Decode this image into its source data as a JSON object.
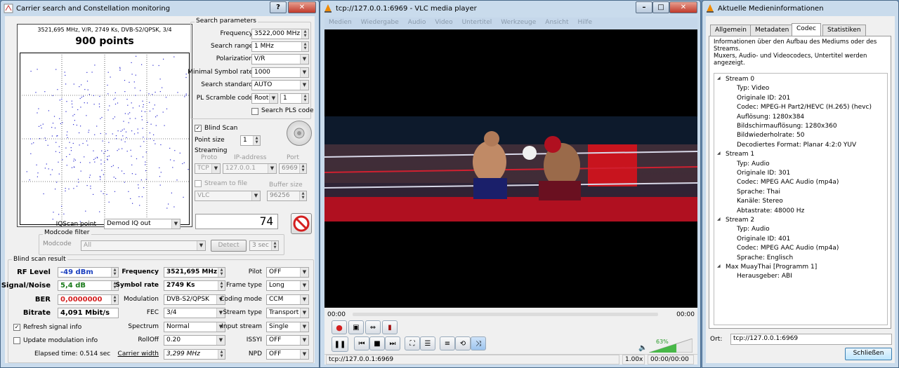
{
  "win1": {
    "title": "Carrier search and Constellation monitoring",
    "help_btn": "?",
    "info_line": "3521,695 MHz, V/R, 2749 Ks, DVB-S2/QPSK, 3/4",
    "points": "900 points",
    "search": {
      "header": "Search parameters",
      "frequency_label": "Frequency",
      "frequency_value": "3522,000 MHz",
      "range_label": "Search range",
      "range_value": "1 MHz",
      "polarization_label": "Polarization",
      "polarization_value": "V/R",
      "minsr_label": "Minimal Symbol rate",
      "minsr_value": "1000",
      "standard_label": "Search standard",
      "standard_value": "AUTO",
      "pls_label": "PL Scramble code",
      "pls_mode": "Root",
      "pls_value": "1",
      "search_pls_label": "Search PLS code"
    },
    "blind_scan_label": "Blind Scan",
    "point_size_label": "Point size",
    "point_size_value": "1",
    "streaming": {
      "header": "Streaming",
      "proto_label": "Proto",
      "ip_label": "IP-address",
      "port_label": "Port",
      "proto_value": "TCP",
      "ip_value": "127.0.0.1",
      "port_value": "6969",
      "to_file_label": "Stream to file",
      "buffer_label": "Buffer size",
      "player_value": "VLC",
      "buffer_value": "96256"
    },
    "iqscan_label": "IQScan point",
    "iqscan_value": "Demod IQ out",
    "counter": "74",
    "modcode": {
      "header": "Modcode filter",
      "label": "Modcode",
      "value": "All",
      "detect_btn": "Detect",
      "sec_value": "3 sec"
    },
    "result": {
      "header": "Blind scan result",
      "rf_label": "RF Level",
      "rf_value": "-49 dBm",
      "sn_label": "Signal/Noise",
      "sn_value": "5,4 dB",
      "ber_label": "BER",
      "ber_value": "0,0000000",
      "bitrate_label": "Bitrate",
      "bitrate_value": "4,091 Mbit/s",
      "freq_label": "Frequency",
      "freq_value": "3521,695 MHz",
      "sr_label": "Symbol rate",
      "sr_value": "2749 Ks",
      "mod_label": "Modulation",
      "mod_value": "DVB-S2/QPSK",
      "fec_label": "FEC",
      "fec_value": "3/4",
      "spectrum_label": "Spectrum",
      "spectrum_value": "Normal",
      "rolloff_label": "RollOff",
      "rolloff_value": "0.20",
      "cw_label": "Carrier width",
      "cw_value": "3,299 MHz",
      "pilot_label": "Pilot",
      "pilot_value": "OFF",
      "frametype_label": "Frame type",
      "frametype_value": "Long",
      "coding_label": "Coding mode",
      "coding_value": "CCM",
      "streamtype_label": "Stream type",
      "streamtype_value": "Transport",
      "inputstream_label": "Input stream",
      "inputstream_value": "Single",
      "issyi_label": "ISSYI",
      "issyi_value": "OFF",
      "npd_label": "NPD",
      "npd_value": "OFF"
    },
    "refresh_label": "Refresh signal info",
    "update_label": "Update modulation info",
    "elapsed": "Elapsed time: 0.514 sec"
  },
  "vlc": {
    "title": "tcp://127.0.0.1:6969 - VLC media player",
    "menu": [
      "Medien",
      "Wiedergabe",
      "Audio",
      "Video",
      "Untertitel",
      "Werkzeuge",
      "Ansicht",
      "Hilfe"
    ],
    "time_start": "00:00",
    "time_end": "00:00",
    "volume": "63%",
    "status_url": "tcp://127.0.0.1:6969",
    "speed": "1.00x",
    "time_status": "00:00/00:00"
  },
  "info": {
    "title": "Aktuelle Medieninformationen",
    "tabs": [
      "Allgemein",
      "Metadaten",
      "Codec",
      "Statistiken"
    ],
    "desc": [
      "Informationen über den Aufbau des Mediums oder des",
      "Streams.",
      "Muxers, Audio- und Videocodecs, Untertitel werden",
      "angezeigt."
    ],
    "tree": [
      {
        "t": "Stream 0",
        "lvl": 0
      },
      {
        "t": "Typ: Video",
        "lvl": 1
      },
      {
        "t": "Originale ID: 201",
        "lvl": 1
      },
      {
        "t": "Codec: MPEG-H Part2/HEVC (H.265) (hevc)",
        "lvl": 1
      },
      {
        "t": "Auflösung: 1280x384",
        "lvl": 1
      },
      {
        "t": "Bildschirmauflösung: 1280x360",
        "lvl": 1
      },
      {
        "t": "Bildwiederholrate: 50",
        "lvl": 1
      },
      {
        "t": "Decodiertes Format: Planar 4:2:0 YUV",
        "lvl": 1
      },
      {
        "t": "Stream 1",
        "lvl": 0
      },
      {
        "t": "Typ: Audio",
        "lvl": 1
      },
      {
        "t": "Originale ID: 301",
        "lvl": 1
      },
      {
        "t": "Codec: MPEG AAC Audio (mp4a)",
        "lvl": 1
      },
      {
        "t": "Sprache: Thai",
        "lvl": 1
      },
      {
        "t": "Kanäle: Stereo",
        "lvl": 1
      },
      {
        "t": "Abtastrate: 48000 Hz",
        "lvl": 1
      },
      {
        "t": "Stream 2",
        "lvl": 0
      },
      {
        "t": "Typ: Audio",
        "lvl": 1
      },
      {
        "t": "Originale ID: 401",
        "lvl": 1
      },
      {
        "t": "Codec: MPEG AAC Audio (mp4a)",
        "lvl": 1
      },
      {
        "t": "Sprache: Englisch",
        "lvl": 1
      },
      {
        "t": "Max MuayThai [Programm 1]",
        "lvl": 0
      },
      {
        "t": "Herausgeber: ABI",
        "lvl": 1
      }
    ],
    "ort_label": "Ort:",
    "ort_value": "tcp://127.0.0.1:6969",
    "close_btn": "Schließen"
  }
}
